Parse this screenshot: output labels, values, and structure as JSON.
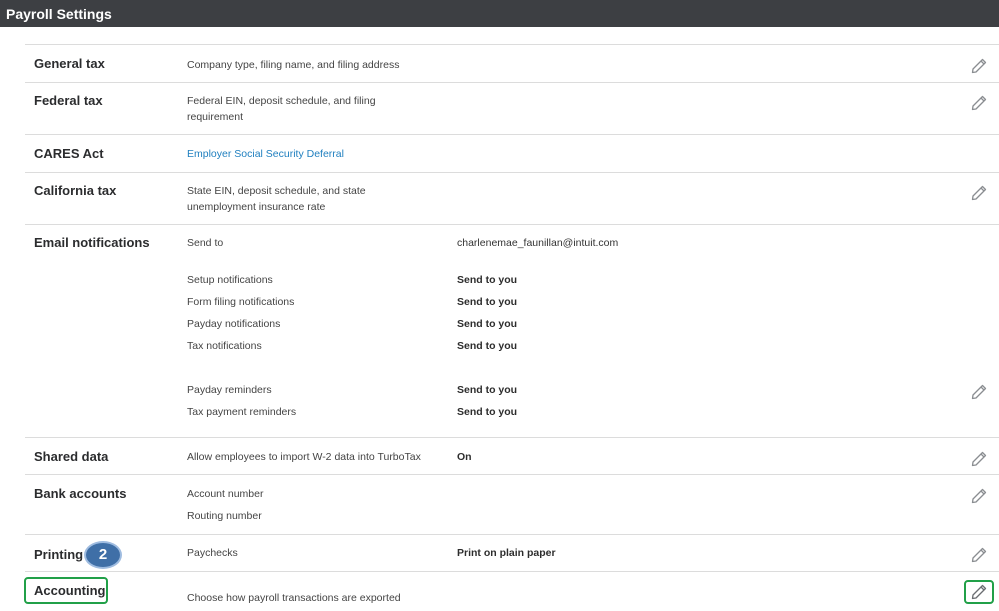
{
  "header": {
    "title": "Payroll Settings"
  },
  "sections": {
    "general_tax": {
      "title": "General tax",
      "desc": "Company type, filing name, and filing address"
    },
    "federal_tax": {
      "title": "Federal tax",
      "desc_1": "Federal EIN, deposit schedule, and filing",
      "desc_2": "requirement"
    },
    "cares_act": {
      "title": "CARES Act",
      "link": "Employer Social Security Deferral"
    },
    "california_tax": {
      "title": "California tax",
      "desc_1": "State EIN, deposit schedule, and state",
      "desc_2": "unemployment insurance rate"
    },
    "email": {
      "title": "Email notifications",
      "send_to_label": "Send to",
      "send_to_value": "charlenemae_faunillan@intuit.com",
      "rows": [
        {
          "label": "Setup notifications",
          "value": "Send to you"
        },
        {
          "label": "Form filing notifications",
          "value": "Send to you"
        },
        {
          "label": "Payday notifications",
          "value": "Send to you"
        },
        {
          "label": "Tax notifications",
          "value": "Send to you"
        },
        {
          "label": "Payday reminders",
          "value": "Send to you"
        },
        {
          "label": "Tax payment reminders",
          "value": "Send to you"
        }
      ]
    },
    "shared_data": {
      "title": "Shared data",
      "desc": "Allow employees to import W-2 data into TurboTax",
      "value": "On"
    },
    "bank_accounts": {
      "title": "Bank accounts",
      "account_label": "Account number",
      "routing_label": "Routing number"
    },
    "printing": {
      "title": "Printing",
      "desc": "Paychecks",
      "value": "Print on plain paper",
      "step_badge": "2"
    },
    "accounting": {
      "title": "Accounting",
      "desc": "Choose how payroll transactions are exported"
    }
  },
  "icons": {
    "edit": "pencil-icon"
  },
  "colors": {
    "header_bg": "#3d3f43",
    "link": "#1f7fbf",
    "highlight": "#21a048",
    "badge": "#3f6fa7"
  }
}
